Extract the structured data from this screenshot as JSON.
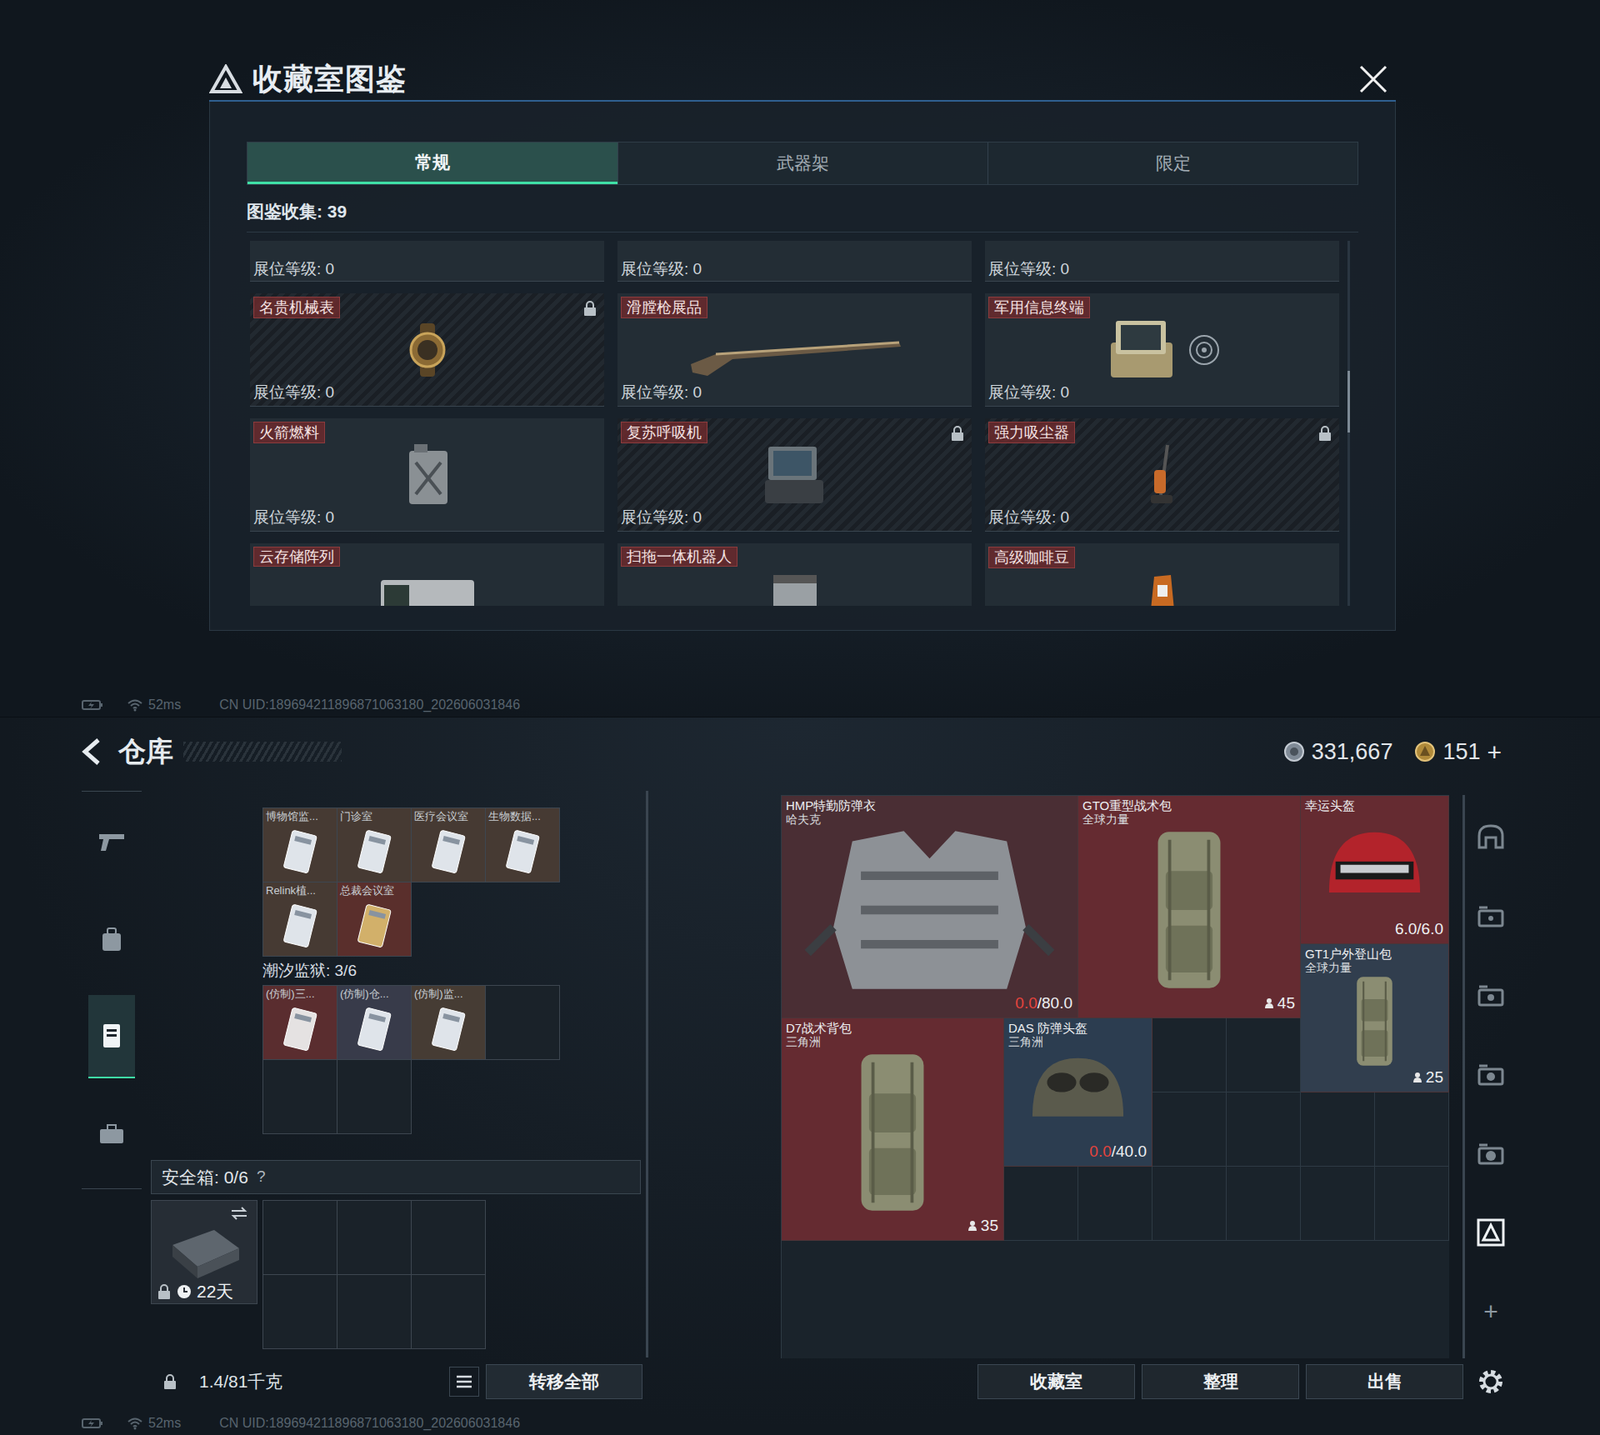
{
  "collection_room": {
    "title": "收藏室图鉴",
    "tabs": [
      {
        "label": "常规",
        "selected": true
      },
      {
        "label": "武器架",
        "selected": false
      },
      {
        "label": "限定",
        "selected": false
      }
    ],
    "collected": "图鉴收集: 39",
    "partial_row": [
      {
        "level": "展位等级: 0"
      },
      {
        "level": "展位等级: 0"
      },
      {
        "level": "展位等级: 0"
      }
    ],
    "cards": [
      {
        "name": "名贵机械表",
        "level": "展位等级: 0",
        "locked": true,
        "kind": "watch"
      },
      {
        "name": "滑膛枪展品",
        "level": "展位等级: 0",
        "locked": false,
        "kind": "musket"
      },
      {
        "name": "军用信息终端",
        "level": "展位等级: 0",
        "locked": false,
        "kind": "terminal"
      },
      {
        "name": "火箭燃料",
        "level": "展位等级: 0",
        "locked": false,
        "kind": "fuel"
      },
      {
        "name": "复苏呼吸机",
        "level": "展位等级: 0",
        "locked": true,
        "kind": "respirator"
      },
      {
        "name": "强力吸尘器",
        "level": "展位等级: 0",
        "locked": true,
        "kind": "vacuum"
      }
    ],
    "cut_row": [
      {
        "name": "云存储阵列",
        "kind": "storage"
      },
      {
        "name": "扫拖一体机器人",
        "kind": "robot"
      },
      {
        "name": "高级咖啡豆",
        "kind": "coffee"
      }
    ]
  },
  "status_top": {
    "ping": "52ms",
    "uid": "CN UID:189694211896871063180_202606031846"
  },
  "warehouse": {
    "title": "仓库",
    "currencies": [
      {
        "amount": "331,667"
      },
      {
        "amount": "151",
        "add": "+"
      }
    ],
    "sidebar": [
      {
        "selected": false
      },
      {
        "selected": false
      },
      {
        "selected": true
      },
      {
        "selected": false
      }
    ],
    "key_groups": [
      {
        "header": "",
        "items": [
          {
            "kind": "key",
            "label": "博物馆监...",
            "color": "#463a33",
            "card_color": "#dfe4ea"
          },
          {
            "kind": "key",
            "label": "门诊室",
            "color": "#463a33",
            "card_color": "#dfe4ea"
          },
          {
            "kind": "key",
            "label": "医疗会议室",
            "color": "#463a33",
            "card_color": "#dfe4ea"
          },
          {
            "kind": "key",
            "label": "生物数据...",
            "color": "#463a33",
            "card_color": "#dfe4ea"
          },
          {
            "kind": "key",
            "label": "Relink植...",
            "color": "#463a33",
            "card_color": "#dfe4ea"
          },
          {
            "kind": "key",
            "label": "总裁会议室",
            "color": "#5a2f2c",
            "card_color": "#d2b06a"
          }
        ]
      },
      {
        "header": "潮汐监狱: 3/6",
        "items": [
          {
            "kind": "key",
            "label": "(仿制)三...",
            "color": "#5a2d2f",
            "card_color": "#e5e2e2"
          },
          {
            "kind": "key",
            "label": "(仿制)仓...",
            "color": "#383b4a",
            "card_color": "#dfe4ea"
          },
          {
            "kind": "key",
            "label": "(仿制)监...",
            "color": "#463c34",
            "card_color": "#dfe4ea"
          },
          {
            "kind": "empty"
          },
          {
            "kind": "empty"
          },
          {
            "kind": "empty"
          }
        ]
      }
    ],
    "safe_box": {
      "label": "安全箱: 0/6",
      "help": "?",
      "timer": "22天",
      "locked": true,
      "slots": [
        {
          "filled": false
        },
        {
          "filled": false
        },
        {
          "filled": false
        },
        {
          "filled": false
        },
        {
          "filled": false
        },
        {
          "filled": false
        }
      ]
    },
    "capacity": "1.4/81千克",
    "transfer_button": "转移全部",
    "stash_items": [
      {
        "name": "HMP特勤防弹衣",
        "brand": "哈夫克",
        "kind": "armor",
        "color": "#4a2e34",
        "current": "0.0",
        "max": "/80.0",
        "depleted": true
      },
      {
        "name": "GTO重型战术包",
        "brand": "全球力量",
        "kind": "backpack",
        "color": "#652b31",
        "capacity": "45"
      },
      {
        "name": "幸运头盔",
        "brand": "",
        "kind": "faceshield",
        "color": "#652b31",
        "current": "6.0",
        "max": "/6.0",
        "depleted": false
      },
      {
        "name": "GT1户外登山包",
        "brand": "全球力量",
        "kind": "backpack",
        "color": "#313e4e",
        "capacity": "25"
      },
      {
        "name": "D7战术背包",
        "brand": "三角洲",
        "kind": "backpack",
        "color": "#652b31",
        "capacity": "35"
      },
      {
        "name": "DAS 防弹头盔",
        "brand": "三角洲",
        "kind": "helmet",
        "color": "#2c3d50",
        "current": "0.0",
        "max": "/40.0",
        "depleted": true
      }
    ],
    "toolbar": [
      {
        "selected": false
      },
      {
        "selected": false
      },
      {
        "selected": false
      },
      {
        "selected": false
      },
      {
        "selected": false
      },
      {
        "selected": true
      }
    ],
    "toolbar_add": "+",
    "actions": [
      "收藏室",
      "整理",
      "出售"
    ]
  },
  "status_bottom": {
    "ping": "52ms",
    "uid": "CN UID:189694211896871063180_202606031846"
  }
}
